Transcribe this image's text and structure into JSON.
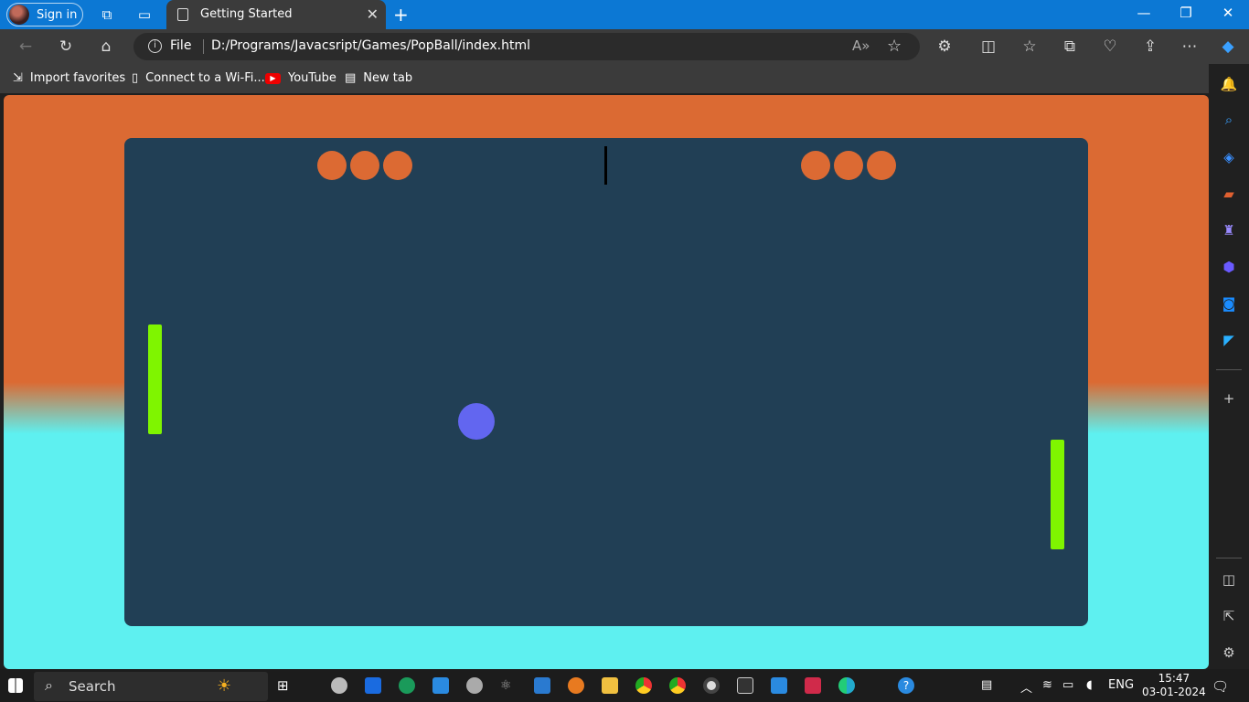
{
  "browser": {
    "sign_in": "Sign in",
    "tab_title": "Getting Started",
    "address": {
      "scheme_label": "File",
      "url": "D:/Programs/Javacsript/Games/PopBall/index.html"
    },
    "favorites": [
      {
        "label": "Import favorites",
        "icon": "import-icon"
      },
      {
        "label": "Connect to a Wi-Fi...",
        "icon": "page-icon"
      },
      {
        "label": "YouTube",
        "icon": "youtube-icon"
      },
      {
        "label": "New tab",
        "icon": "newtab-icon"
      }
    ]
  },
  "game": {
    "left_lives": 3,
    "right_lives": 3,
    "colors": {
      "background_top": "#db6a33",
      "background_bottom": "#5ef0f0",
      "board": "#213f55",
      "paddle": "#7ff500",
      "ball": "#6266f0",
      "life": "#dc6a33"
    }
  },
  "taskbar": {
    "search_label": "Search",
    "language": "ENG",
    "time": "15:47",
    "date": "03-01-2024"
  }
}
